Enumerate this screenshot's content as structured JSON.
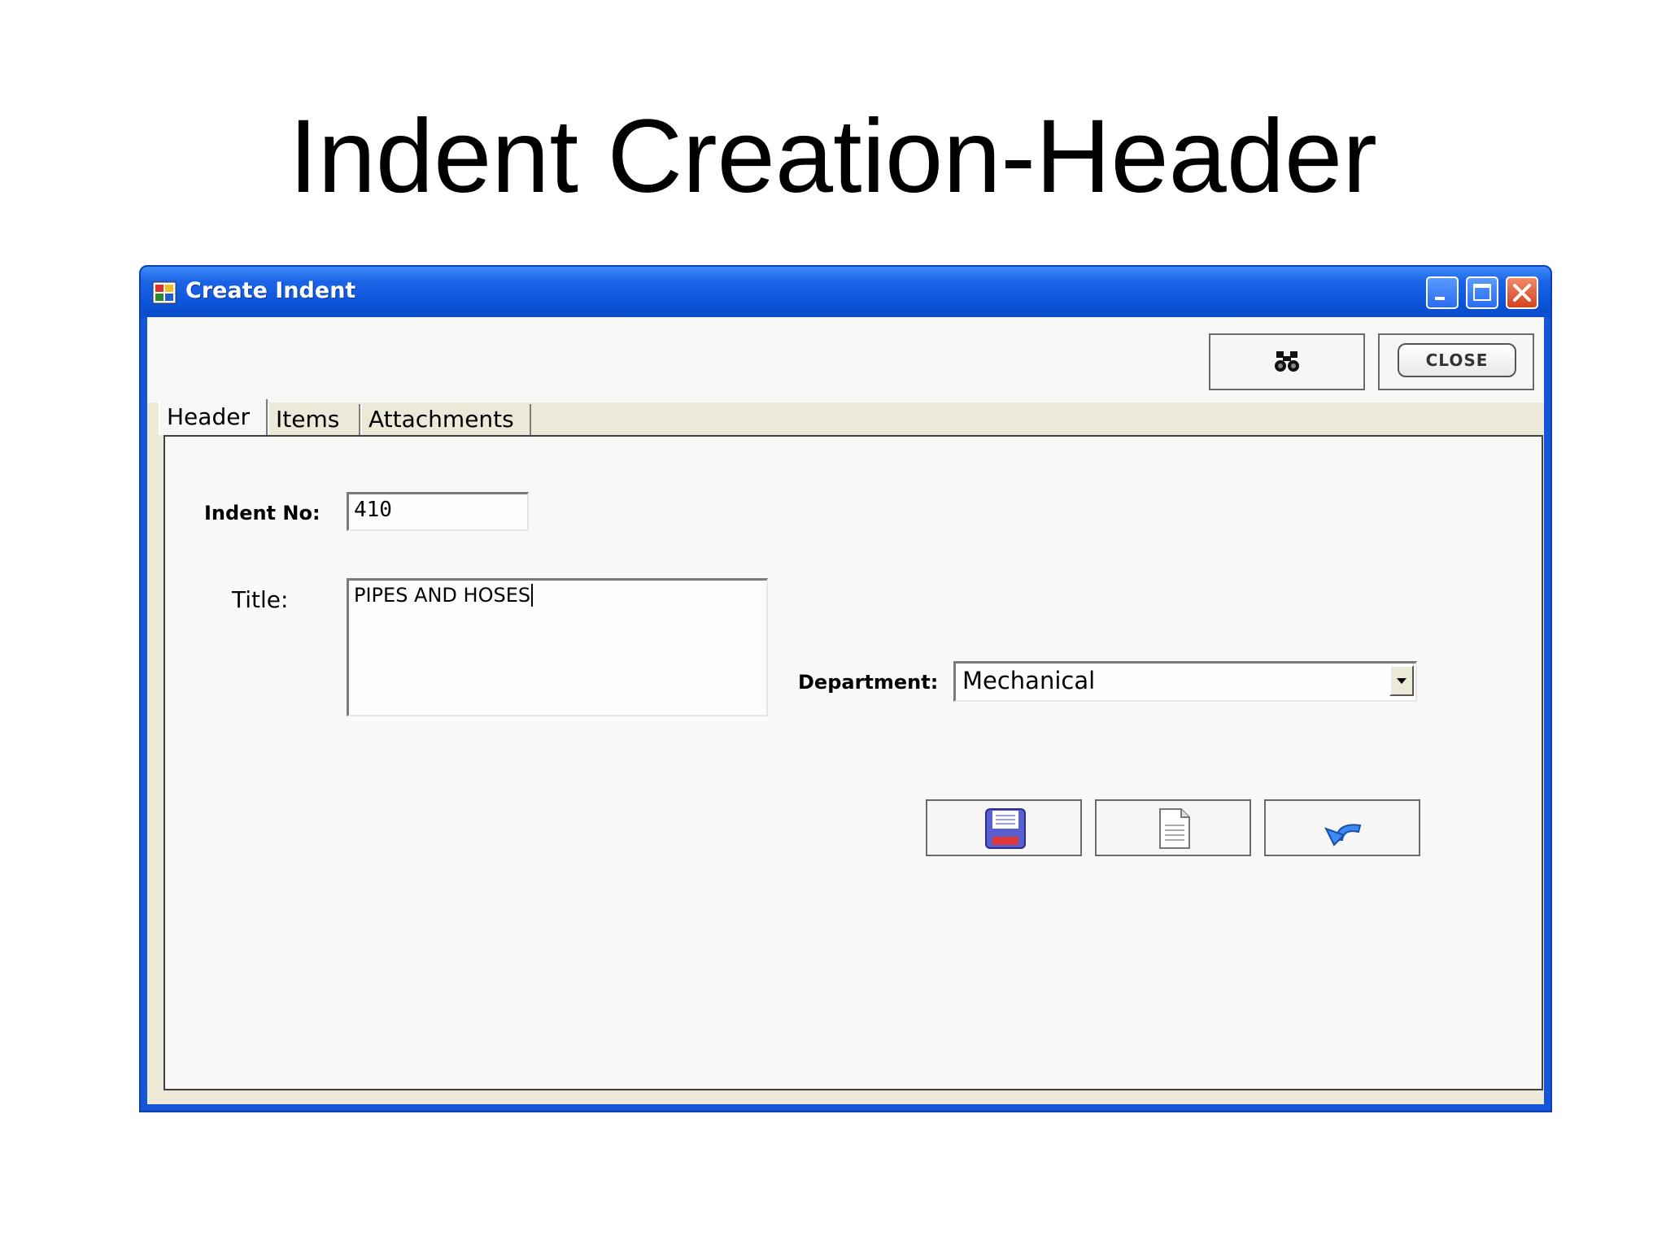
{
  "slide": {
    "title": "Indent Creation-Header"
  },
  "window": {
    "title": "Create Indent",
    "controls": {
      "minimize": "minimize-icon",
      "maximize": "maximize-icon",
      "close": "close-icon"
    }
  },
  "toolbar": {
    "find_icon": "binoculars-icon",
    "close_label": "CLOSE"
  },
  "tabs": [
    {
      "label": "Header",
      "selected": true
    },
    {
      "label": "Items",
      "selected": false
    },
    {
      "label": "Attachments",
      "selected": false
    }
  ],
  "form": {
    "indent_no_label": "Indent No:",
    "indent_no_value": "410",
    "title_label": "Title:",
    "title_value": "PIPES AND HOSES",
    "department_label": "Department:",
    "department_value": "Mechanical"
  },
  "actions": {
    "save_icon": "floppy-disk-icon",
    "new_icon": "new-document-icon",
    "undo_icon": "undo-arrow-icon"
  },
  "colors": {
    "titlebar": "#0d55dc",
    "client": "#ece9d8",
    "close_button_red": "#d4421c"
  }
}
